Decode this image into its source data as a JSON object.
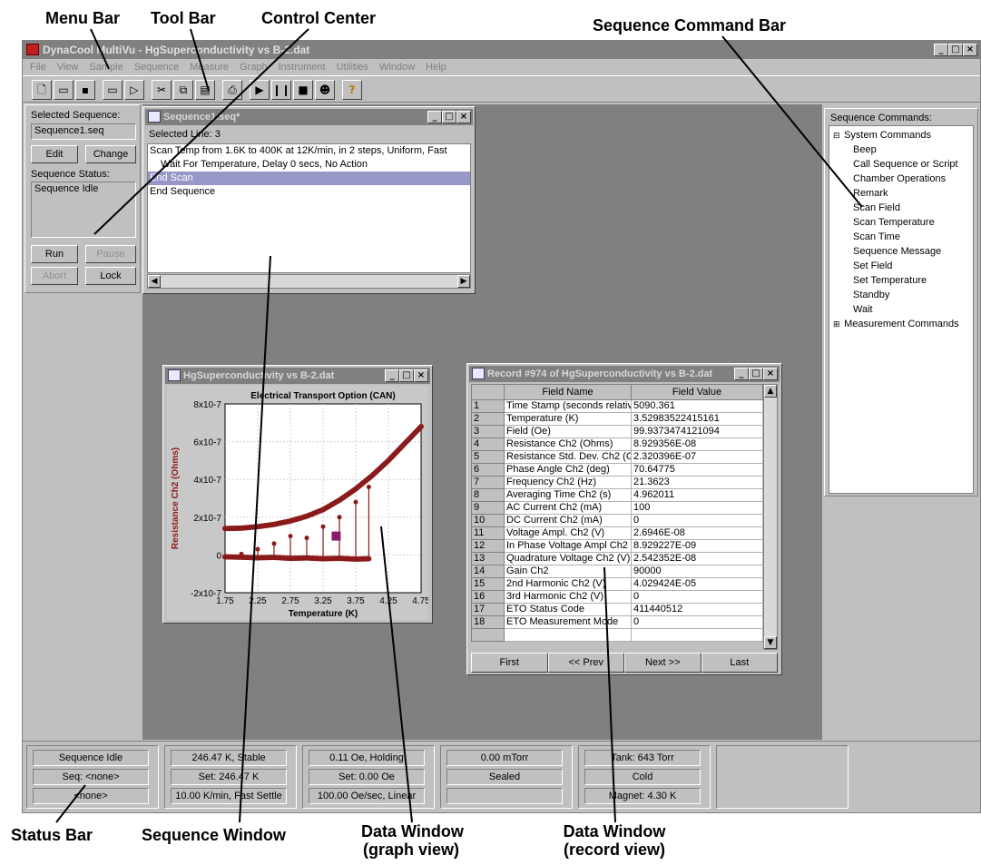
{
  "annotations": {
    "menu_bar": "Menu Bar",
    "tool_bar": "Tool Bar",
    "control_center": "Control Center",
    "sequence_command_bar": "Sequence Command Bar",
    "status_bar": "Status Bar",
    "sequence_window": "Sequence Window",
    "data_window_graph_1": "Data Window",
    "data_window_graph_2": "(graph view)",
    "data_window_record_1": "Data Window",
    "data_window_record_2": "(record view)"
  },
  "app": {
    "title": "DynaCool MultiVu - HgSuperconductivity vs B-2.dat",
    "menu": [
      "File",
      "View",
      "Sample",
      "Sequence",
      "Measure",
      "Graph",
      "Instrument",
      "Utilities",
      "Window",
      "Help"
    ]
  },
  "control_center": {
    "selected_sequence_label": "Selected Sequence:",
    "selected_sequence_value": "Sequence1.seq",
    "edit_label": "Edit",
    "change_label": "Change",
    "status_label": "Sequence Status:",
    "status_value": "Sequence Idle",
    "run_label": "Run",
    "pause_label": "Pause",
    "abort_label": "Abort",
    "lock_label": "Lock"
  },
  "sequence_window": {
    "title": "Sequence1.seq*",
    "selected_line": "Selected Line: 3",
    "lines": [
      "Scan Temp from 1.6K to 400K at 12K/min, in 2 steps, Uniform, Fast",
      "Wait For Temperature, Delay 0 secs, No Action",
      "End Scan",
      "End Sequence"
    ]
  },
  "graph_window": {
    "title": "HgSuperconductivity vs B-2.dat"
  },
  "chart_data": {
    "type": "scatter",
    "title": "Electrical Transport Option (CAN)",
    "xlabel": "Temperature (K)",
    "ylabel": "Resistance Ch2 (Ohms)",
    "xlim": [
      1.75,
      4.75
    ],
    "ylim": [
      -2e-07,
      8e-07
    ],
    "x_ticks": [
      "1.75",
      "2.25",
      "2.75",
      "3.25",
      "3.75",
      "4.25",
      "4.75"
    ],
    "y_ticks": [
      "-2x10-7",
      "0",
      "2x10-7",
      "4x10-7",
      "6x10-7",
      "8x10-7"
    ],
    "grid": true,
    "color": "#8b1a1a",
    "series": [
      {
        "x": [
          1.75,
          2.0,
          2.25,
          2.5,
          2.75,
          3.0,
          3.25,
          3.5,
          3.75,
          4.0,
          4.25,
          4.5,
          4.75
        ],
        "y": [
          1.4e-07,
          1.42e-07,
          1.5e-07,
          1.62e-07,
          1.8e-07,
          2.05e-07,
          2.4e-07,
          2.9e-07,
          3.5e-07,
          4.2e-07,
          5e-07,
          5.9e-07,
          6.8e-07
        ]
      },
      {
        "x": [
          1.75,
          2.0,
          2.25,
          2.5,
          2.75,
          3.0,
          3.25,
          3.5,
          3.75,
          3.95
        ],
        "y": [
          -1e-08,
          -1.2e-08,
          -1.5e-08,
          -1.3e-08,
          -1.8e-08,
          -1.6e-08,
          -2e-08,
          -1.8e-08,
          -2.2e-08,
          -2e-08
        ]
      }
    ],
    "spikes": [
      {
        "x": 2.0,
        "y": 5e-09
      },
      {
        "x": 2.25,
        "y": 3e-08
      },
      {
        "x": 2.5,
        "y": 6e-08
      },
      {
        "x": 2.75,
        "y": 1e-07
      },
      {
        "x": 3.0,
        "y": 9e-08
      },
      {
        "x": 3.25,
        "y": 1.5e-07
      },
      {
        "x": 3.5,
        "y": 2e-07
      },
      {
        "x": 3.75,
        "y": 2.8e-07
      },
      {
        "x": 3.95,
        "y": 3.6e-07
      }
    ],
    "marker": {
      "x": 3.45,
      "y": 1e-07,
      "color": "#8b1a6b"
    }
  },
  "record_window": {
    "title": "Record #974 of HgSuperconductivity vs B-2.dat",
    "headers": [
      "",
      "Field Name",
      "Field Value"
    ],
    "rows": [
      [
        "1",
        "Time Stamp (seconds relativ",
        "5090.361"
      ],
      [
        "2",
        "Temperature (K)",
        "3.52983522415161"
      ],
      [
        "3",
        "Field (Oe)",
        "99.9373474121094"
      ],
      [
        "4",
        "Resistance Ch2 (Ohms)",
        "8.929356E-08"
      ],
      [
        "5",
        "Resistance Std. Dev. Ch2 (C",
        "2.320396E-07"
      ],
      [
        "6",
        "Phase Angle Ch2 (deg)",
        "70.64775"
      ],
      [
        "7",
        "Frequency Ch2 (Hz)",
        "21.3623"
      ],
      [
        "8",
        "Averaging Time Ch2 (s)",
        "4.962011"
      ],
      [
        "9",
        "AC Current Ch2 (mA)",
        "100"
      ],
      [
        "10",
        "DC Current Ch2 (mA)",
        "0"
      ],
      [
        "11",
        "Voltage Ampl. Ch2 (V)",
        "2.6946E-08"
      ],
      [
        "12",
        "In Phase Voltage Ampl Ch2 (",
        "8.929227E-09"
      ],
      [
        "13",
        "Quadrature Voltage Ch2 (V)",
        "2.542352E-08"
      ],
      [
        "14",
        "Gain Ch2",
        "90000"
      ],
      [
        "15",
        "2nd Harmonic Ch2 (V)",
        "4.029424E-05"
      ],
      [
        "16",
        "3rd Harmonic Ch2 (V)",
        "0"
      ],
      [
        "17",
        "ETO Status Code",
        "411440512"
      ],
      [
        "18",
        "ETO Measurement Mode",
        "0"
      ]
    ],
    "nav": [
      "First",
      "<< Prev",
      "Next >>",
      "Last"
    ]
  },
  "sequence_commands": {
    "label": "Sequence Commands:",
    "system_label": "System Commands",
    "system_items": [
      "Beep",
      "Call Sequence or Script",
      "Chamber Operations",
      "Remark",
      "Scan Field",
      "Scan Temperature",
      "Scan Time",
      "Sequence Message",
      "Set Field",
      "Set Temperature",
      "Standby",
      "Wait"
    ],
    "measurement_label": "Measurement Commands"
  },
  "status_bar": {
    "seq": [
      "Sequence Idle",
      "Seq: <none>",
      "<none>"
    ],
    "temp": [
      "246.47 K, Stable",
      "Set: 246.47 K",
      "10.00 K/min, Fast Settle"
    ],
    "field": [
      "0.11 Oe, Holding",
      "Set: 0.00 Oe",
      "100.00 Oe/sec, Linear"
    ],
    "pressure": [
      "0.00 mTorr",
      "Sealed",
      ""
    ],
    "tank": [
      "Tank: 643 Torr",
      "Cold",
      "Magnet: 4.30 K"
    ]
  }
}
